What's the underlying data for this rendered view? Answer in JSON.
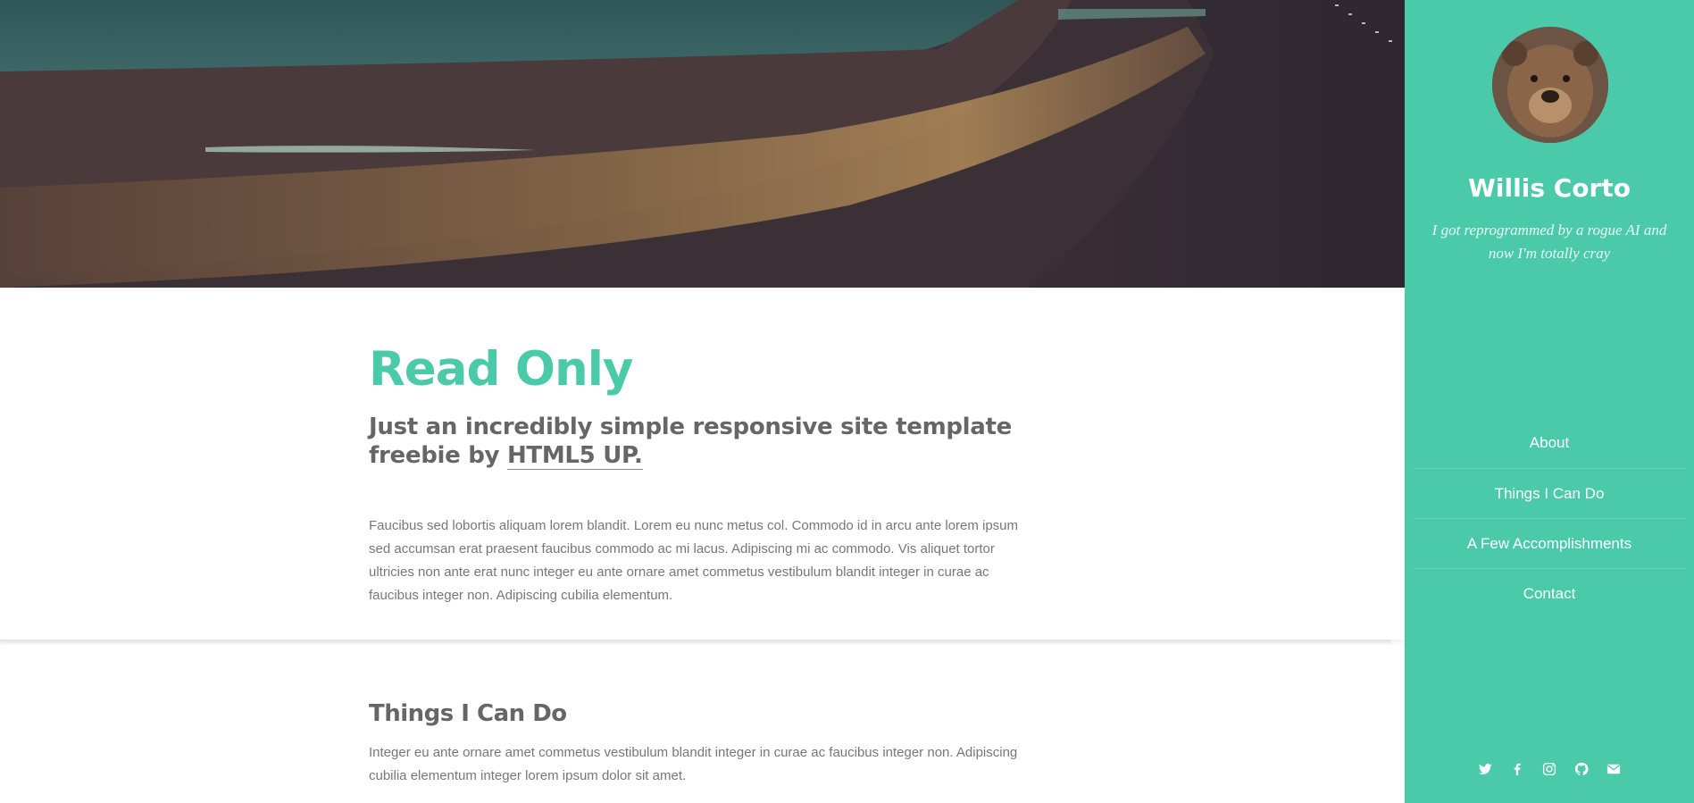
{
  "main": {
    "intro": {
      "title": "Read Only",
      "subtitle_prefix": "Just an incredibly simple responsive site template freebie by",
      "subtitle_link": "HTML5 UP.",
      "body": "Faucibus sed lobortis aliquam lorem blandit. Lorem eu nunc metus col. Commodo id in arcu ante lorem ipsum sed accumsan erat praesent faucibus commodo ac mi lacus. Adipiscing mi ac commodo. Vis aliquet tortor ultricies non ante erat nunc integer eu ante ornare amet commetus vestibulum blandit integer in curae ac faucibus integer non. Adipiscing cubilia elementum."
    },
    "things": {
      "title": "Things I Can Do",
      "body": "Integer eu ante ornare amet commetus vestibulum blandit integer in curae ac faucibus integer non. Adipiscing cubilia elementum integer lorem ipsum dolor sit amet."
    }
  },
  "sidebar": {
    "name": "Willis Corto",
    "tagline": "I got reprogrammed by a rogue AI and now I'm totally cray",
    "nav": [
      {
        "label": "About"
      },
      {
        "label": "Things I Can Do"
      },
      {
        "label": "A Few Accomplishments"
      },
      {
        "label": "Contact"
      }
    ],
    "social": [
      "twitter-icon",
      "facebook-icon",
      "instagram-icon",
      "github-icon",
      "email-icon"
    ]
  },
  "colors": {
    "accent": "#4acaa8",
    "heading": "#666666",
    "text": "#777777"
  }
}
